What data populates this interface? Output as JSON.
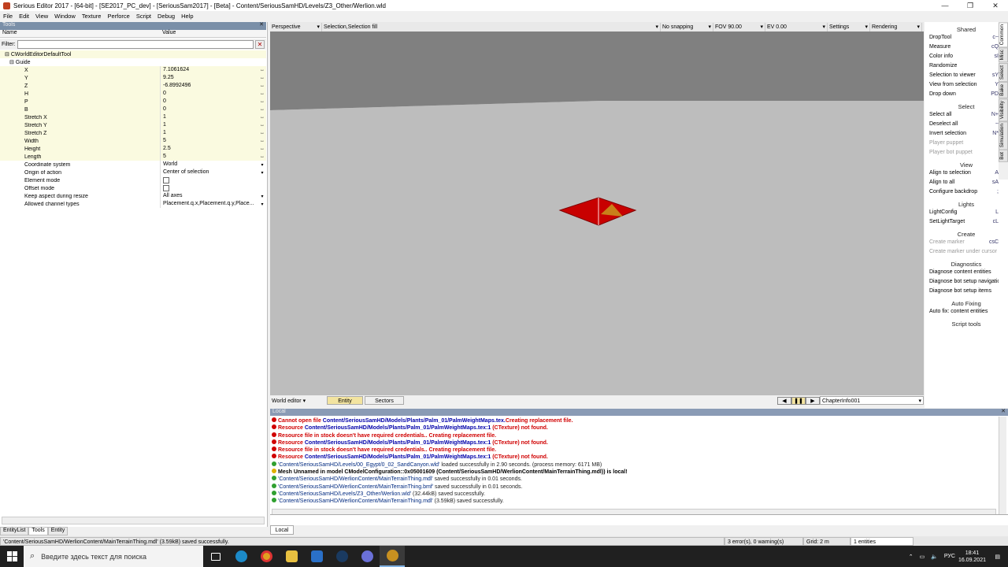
{
  "window": {
    "title": "Serious Editor 2017 - [64-bit] - [SE2017_PC_dev] - [SeriousSam2017] - [Beta] - Content/SeriousSamHD/Levels/Z3_Other/Werlion.wld"
  },
  "menu": [
    "File",
    "Edit",
    "View",
    "Window",
    "Texture",
    "Perforce",
    "Script",
    "Debug",
    "Help"
  ],
  "tools": {
    "header": "Tools",
    "col_name": "Name",
    "col_value": "Value",
    "filter_label": "Filter:",
    "filter_value": "",
    "root": "CWorldEditorDefaultTool",
    "group": "Guide",
    "props": [
      {
        "name": "X",
        "value": "7.1061624"
      },
      {
        "name": "Y",
        "value": "9.25"
      },
      {
        "name": "Z",
        "value": "-6.8992496"
      },
      {
        "name": "H",
        "value": "0"
      },
      {
        "name": "P",
        "value": "0"
      },
      {
        "name": "B",
        "value": "0"
      },
      {
        "name": "Stretch X",
        "value": "1"
      },
      {
        "name": "Stretch Y",
        "value": "1"
      },
      {
        "name": "Stretch Z",
        "value": "1"
      },
      {
        "name": "Width",
        "value": "5"
      },
      {
        "name": "Height",
        "value": "2.5"
      },
      {
        "name": "Length",
        "value": "5"
      },
      {
        "name": "Coordinate system",
        "value": "World"
      },
      {
        "name": "Origin of action",
        "value": "Center of selection"
      },
      {
        "name": "Element mode",
        "value": ""
      },
      {
        "name": "Offset mode",
        "value": ""
      },
      {
        "name": "Keep aspect during resize",
        "value": "All axes"
      },
      {
        "name": "Allowed channel types",
        "value": "Placement.q.x,Placement.q.y,Place..."
      }
    ],
    "bottom_tabs": [
      "EntityList",
      "Tools",
      "Entity"
    ]
  },
  "viewport_toolbar": {
    "projection": "Perspective",
    "selection": "Selection,Selection fill",
    "snapping": "No snapping",
    "fov": "FOV 90.00",
    "ev": "EV  0.00",
    "settings": "Settings",
    "rendering": "Rendering"
  },
  "viewport_bar": {
    "mode": "World editor",
    "tab_entity": "Entity",
    "tab_sectors": "Sectors",
    "chapter": "ChapterInfo001"
  },
  "right_panel": {
    "sections": [
      {
        "title": "Shared",
        "items": [
          {
            "label": "DropTool",
            "sc": "c~",
            "dis": false
          },
          {
            "label": "Measure",
            "sc": "cQ",
            "dis": false
          },
          {
            "label": "Color info",
            "sc": "sI",
            "dis": false
          },
          {
            "label": "Randomize",
            "sc": "",
            "dis": false
          },
          {
            "label": "Selection to viewer",
            "sc": "sY",
            "dis": false
          },
          {
            "label": "View from selection",
            "sc": "Y",
            "dis": false
          },
          {
            "label": "Drop down",
            "sc": "PD",
            "dis": false
          }
        ]
      },
      {
        "title": "Select",
        "items": [
          {
            "label": "Select all",
            "sc": "N+",
            "dis": false
          },
          {
            "label": "Deselect all",
            "sc": "~",
            "dis": false
          },
          {
            "label": "Invert selection",
            "sc": "N*",
            "dis": false
          },
          {
            "label": "Player puppet",
            "sc": "",
            "dis": true
          },
          {
            "label": "Player bot puppet",
            "sc": "",
            "dis": true
          }
        ]
      },
      {
        "title": "View",
        "items": [
          {
            "label": "Align to selection",
            "sc": "A",
            "dis": false
          },
          {
            "label": "Align to all",
            "sc": "sA",
            "dis": false
          },
          {
            "label": "Configure backdrop",
            "sc": ";",
            "dis": false
          }
        ]
      },
      {
        "title": "Lights",
        "items": [
          {
            "label": "LightConfig",
            "sc": "L",
            "dis": false
          },
          {
            "label": "SetLightTarget",
            "sc": "cL",
            "dis": false
          }
        ]
      },
      {
        "title": "Create",
        "items": [
          {
            "label": "Create marker",
            "sc": "csC",
            "dis": true
          },
          {
            "label": "Create marker under cursor",
            "sc": "",
            "dis": true
          }
        ]
      },
      {
        "title": "Diagnostics",
        "items": [
          {
            "label": "Diagnose content entities",
            "sc": "",
            "dis": false
          },
          {
            "label": "Diagnose bot setup navigation",
            "sc": "",
            "dis": false
          },
          {
            "label": "Diagnose bot setup items",
            "sc": "",
            "dis": false
          }
        ]
      },
      {
        "title": "Auto Fixing",
        "items": [
          {
            "label": "Auto fix: content entities",
            "sc": "",
            "dis": false
          }
        ]
      },
      {
        "title": "Script tools",
        "items": []
      }
    ],
    "vtabs": [
      "Common",
      "Misc",
      "Select",
      "Bake",
      "Visibility",
      "Simulation",
      "Bot"
    ]
  },
  "log": {
    "header": "Local",
    "lines": [
      {
        "t": "err",
        "parts": [
          "Cannot open file ",
          "Content/SeriousSamHD/Models/Plants/Palm_01/PalmWeightMaps.tex.",
          "Creating replacement file."
        ]
      },
      {
        "t": "err",
        "parts": [
          "Resource ",
          "Content/SeriousSamHD/Models/Plants/Palm_01/PalmWeightMaps.tex:1",
          " (CTexture) not found."
        ]
      },
      {
        "t": "err",
        "parts": [
          "Resource file in stock doesn't have required credentials.. Creating replacement file.",
          "",
          ""
        ]
      },
      {
        "t": "err",
        "parts": [
          "Resource ",
          "Content/SeriousSamHD/Models/Plants/Palm_01/PalmWeightMaps.tex:1",
          " (CTexture) not found."
        ]
      },
      {
        "t": "err",
        "parts": [
          "Resource file in stock doesn't have required credentials.. Creating replacement file.",
          "",
          ""
        ]
      },
      {
        "t": "err",
        "parts": [
          "Resource ",
          "Content/SeriousSamHD/Models/Plants/Palm_01/PalmWeightMaps.tex:1",
          " (CTexture) not found."
        ]
      },
      {
        "t": "ok",
        "parts": [
          "",
          "'Content/SeriousSamHD/Levels/00_Egypt/0_02_SandCanyon.wld'",
          " loaded successfully in 2.90 seconds. (process memory: 6171 MB)"
        ]
      },
      {
        "t": "warn",
        "parts": [
          "Mesh Unnamed in model CModelConfiguration::0x05001609",
          " (Content/SeriousSamHD/WerlionContent/MainTerrainThing.mdl)",
          ") is local!"
        ]
      },
      {
        "t": "ok",
        "parts": [
          "",
          "'Content/SeriousSamHD/WerlionContent/MainTerrainThing.mdl'",
          " saved successfully in 0.01 seconds."
        ]
      },
      {
        "t": "ok",
        "parts": [
          "",
          "'Content/SeriousSamHD/WerlionContent/MainTerrainThing.bmf'",
          " saved successfully in 0.01 seconds."
        ]
      },
      {
        "t": "ok",
        "parts": [
          "",
          "'Content/SeriousSamHD/Levels/Z3_Other/Werlion.wld'",
          " (32.44kB) saved successfully."
        ]
      },
      {
        "t": "ok",
        "parts": [
          "",
          "'Content/SeriousSamHD/WerlionContent/MainTerrainThing.mdl'",
          " (3.59kB) saved successfully."
        ]
      }
    ],
    "local_tab": "Local"
  },
  "status": {
    "message": "'Content/SeriousSamHD/WerlionContent/MainTerrainThing.mdl' (3.59kB) saved successfully.",
    "errors": "3 error(s), 0 warning(s)",
    "grid": "Grid: 2 m",
    "entities": "1 entities"
  },
  "taskbar": {
    "search_placeholder": "Введите здесь текст для поиска",
    "lang": "РУС",
    "time": "18:41",
    "date": "16.09.2021"
  },
  "colors": {
    "error": "#d00000",
    "resource": "#0000aa",
    "tile_red": "#c80000",
    "floor": "#bdbdbd",
    "sky": "#808080"
  }
}
